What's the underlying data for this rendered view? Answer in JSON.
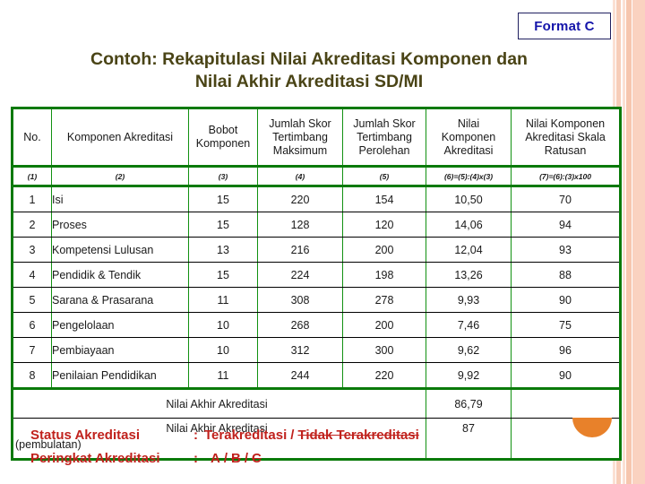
{
  "badge": {
    "label": "Format C"
  },
  "title": {
    "line1": "Contoh: Rekapitulasi Nilai Akreditasi Komponen dan",
    "line2": "Nilai Akhir Akreditasi SD/MI"
  },
  "table": {
    "headers": {
      "no": "No.",
      "komponen": "Komponen Akreditasi",
      "bobot": "Bobot Komponen",
      "maksimum": "Jumlah Skor Tertimbang Maksimum",
      "perolehan": "Jumlah Skor Tertimbang Perolehan",
      "nilai": "Nilai Komponen Akreditasi",
      "skala": "Nilai Komponen Akreditasi Skala Ratusan"
    },
    "header_lines": {
      "bobot": [
        "Bobot",
        "Komponen"
      ],
      "maksimum": [
        "Jumlah Skor",
        "Tertimbang",
        "Maksimum"
      ],
      "perolehan": [
        "Jumlah Skor",
        "Tertimbang",
        "Perolehan"
      ],
      "nilai": [
        "Nilai",
        "Komponen",
        "Akreditasi"
      ],
      "skala": [
        "Nilai Komponen",
        "Akreditasi Skala",
        "Ratusan"
      ]
    },
    "numbering": [
      "(1)",
      "(2)",
      "(3)",
      "(4)",
      "(5)",
      "(6)=(5):(4)x(3)",
      "(7)=(6):(3)x100"
    ],
    "rows": [
      {
        "no": "1",
        "komponen": "Isi",
        "bobot": "15",
        "maksimum": "220",
        "perolehan": "154",
        "nilai": "10,50",
        "skala": "70"
      },
      {
        "no": "2",
        "komponen": "Proses",
        "bobot": "15",
        "maksimum": "128",
        "perolehan": "120",
        "nilai": "14,06",
        "skala": "94"
      },
      {
        "no": "3",
        "komponen": "Kompetensi Lulusan",
        "bobot": "13",
        "maksimum": "216",
        "perolehan": "200",
        "nilai": "12,04",
        "skala": "93"
      },
      {
        "no": "4",
        "komponen": "Pendidik & Tendik",
        "bobot": "15",
        "maksimum": "224",
        "perolehan": "198",
        "nilai": "13,26",
        "skala": "88"
      },
      {
        "no": "5",
        "komponen": "Sarana & Prasarana",
        "bobot": "11",
        "maksimum": "308",
        "perolehan": "278",
        "nilai": "9,93",
        "skala": "90"
      },
      {
        "no": "6",
        "komponen": "Pengelolaan",
        "bobot": "10",
        "maksimum": "268",
        "perolehan": "200",
        "nilai": "7,46",
        "skala": "75"
      },
      {
        "no": "7",
        "komponen": "Pembiayaan",
        "bobot": "10",
        "maksimum": "312",
        "perolehan": "300",
        "nilai": "9,62",
        "skala": "96"
      },
      {
        "no": "8",
        "komponen": "Penilaian Pendidikan",
        "bobot": "11",
        "maksimum": "244",
        "perolehan": "220",
        "nilai": "9,92",
        "skala": "90"
      }
    ],
    "summary": [
      {
        "label": "Nilai Akhir Akreditasi",
        "value": "86,79",
        "note": ""
      },
      {
        "label": "Nilai Akhir Akreditasi",
        "value": "87",
        "note": "(pembulatan)"
      }
    ]
  },
  "footer": {
    "status_label": "Status Akreditasi",
    "status_colon": ":",
    "status_yes": "Terakreditasi",
    "status_sep": "/",
    "status_no": "Tidak Terakreditasi",
    "rank_label": "Peringkat Akreditasi",
    "rank_colon": ":",
    "rank_a": "A",
    "rank_sep1": "/",
    "rank_b": "B",
    "rank_sep2": "/",
    "rank_c": "C"
  },
  "colors": {
    "badge_text": "#1414aa",
    "title": "#4a4416",
    "table_frame": "#0a7a0a",
    "numeric_navy": "#1f2a70",
    "footer_red": "#c0211c",
    "orange_accent": "#e8812a",
    "stripe_peach": "#f7cdb8"
  }
}
